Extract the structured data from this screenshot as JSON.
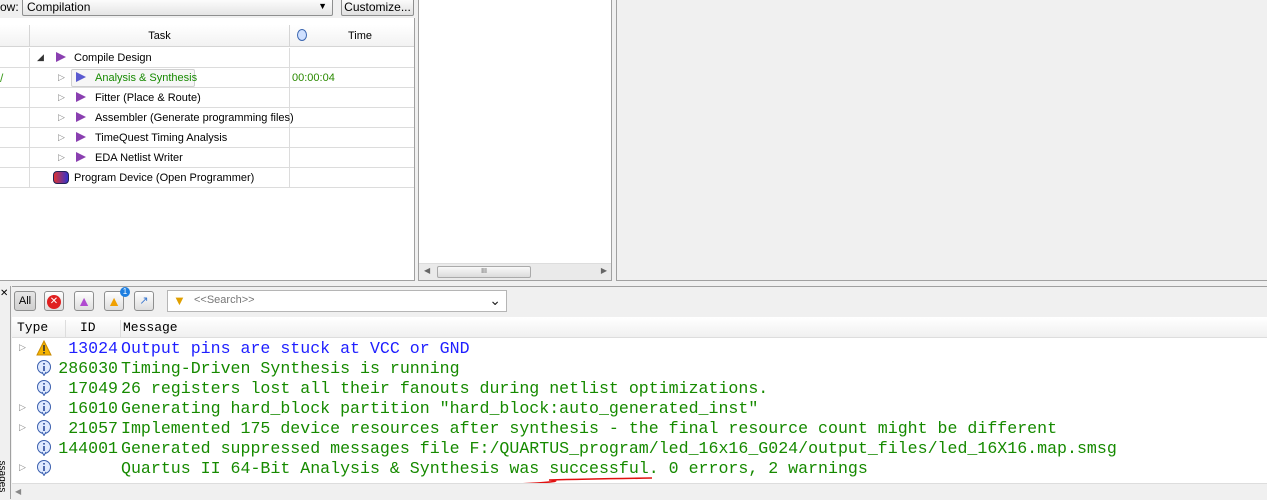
{
  "flow": {
    "label": "ow:",
    "selected": "Compilation",
    "customize": "Customize..."
  },
  "tasks": {
    "header_task": "Task",
    "header_time": "Time",
    "rows": [
      {
        "label": "Compile Design",
        "time": ""
      },
      {
        "label": "Analysis & Synthesis",
        "time": "00:00:04"
      },
      {
        "label": "Fitter (Place & Route)",
        "time": ""
      },
      {
        "label": "Assembler (Generate programming files)",
        "time": ""
      },
      {
        "label": "TimeQuest Timing Analysis",
        "time": ""
      },
      {
        "label": "EDA Netlist Writer",
        "time": ""
      },
      {
        "label": "Program Device (Open Programmer)",
        "time": ""
      }
    ]
  },
  "scroll_thumb": "III",
  "side_tab": "ssages",
  "messages": {
    "filter_all": "All",
    "warning_badge": "1",
    "search_placeholder": "<<Search>>",
    "columns": {
      "type": "Type",
      "id": "ID",
      "message": "Message"
    },
    "colors": {
      "warning": "#1f1fff",
      "info": "#168a00"
    },
    "rows": [
      {
        "type": "warning",
        "id": "13024",
        "text": "Output pins are stuck at VCC or GND",
        "expand": true
      },
      {
        "type": "info",
        "id": "286030",
        "text": "Timing-Driven Synthesis is running",
        "expand": false
      },
      {
        "type": "info",
        "id": "17049",
        "text": "26 registers lost all their fanouts during netlist optimizations.",
        "expand": false
      },
      {
        "type": "info",
        "id": "16010",
        "text": "Generating hard_block partition \"hard_block:auto_generated_inst\"",
        "expand": true
      },
      {
        "type": "info",
        "id": "21057",
        "text": "Implemented 175 device resources after synthesis - the final resource count might be different",
        "expand": true
      },
      {
        "type": "info",
        "id": "144001",
        "text": "Generated suppressed messages file F:/QUARTUS_program/led_16x16_G024/output_files/led_16X16.map.smsg",
        "expand": false
      },
      {
        "type": "info",
        "id": "",
        "text": "Quartus II 64-Bit Analysis & Synthesis was successful. 0 errors, 2 warnings",
        "expand": true
      }
    ]
  }
}
